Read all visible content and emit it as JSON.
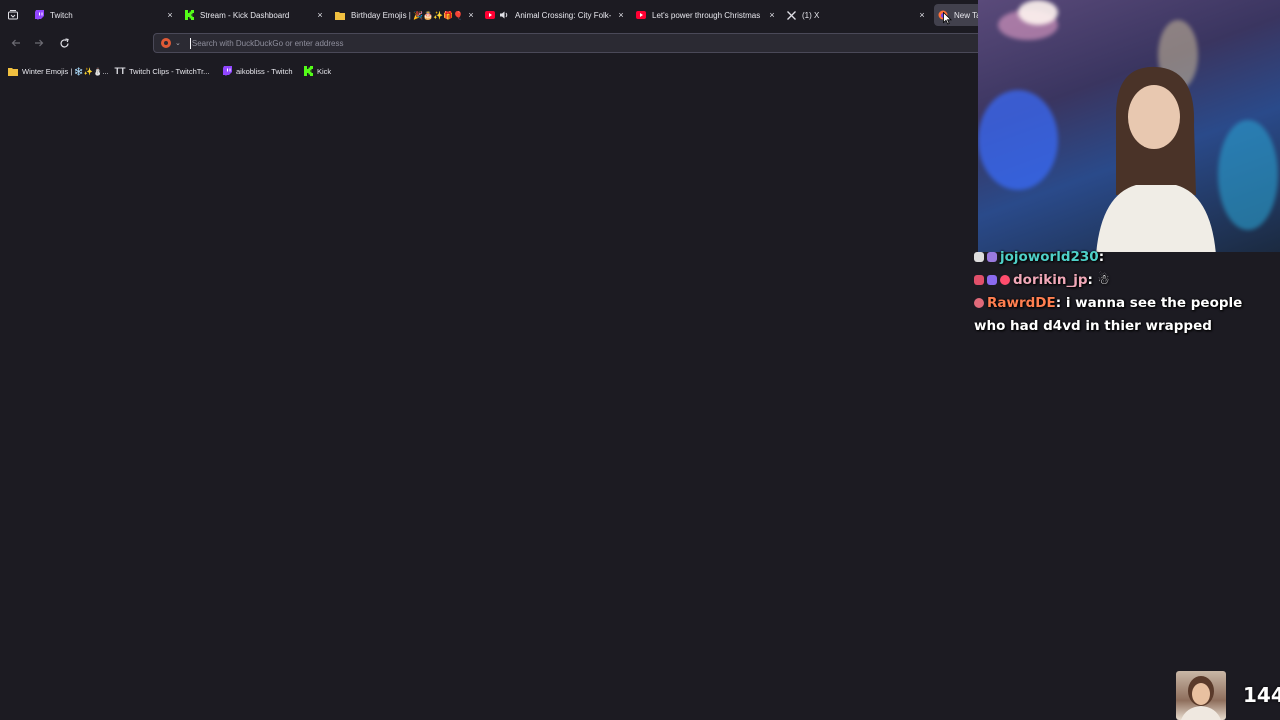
{
  "tabs": [
    {
      "title": "Twitch",
      "icon": "twitch-icon",
      "close": "×"
    },
    {
      "title": "Stream - Kick Dashboard",
      "icon": "kick-icon",
      "close": "×"
    },
    {
      "title": "Birthday Emojis | 🎉🎂✨🎁🎈",
      "icon": "folder-icon",
      "close": "×"
    },
    {
      "title": "Animal Crossing: City Folk-",
      "icon": "youtube-icon",
      "close": "×"
    },
    {
      "title": "Let's power through Christmas",
      "icon": "youtube-icon",
      "close": "×"
    },
    {
      "title": "(1) X",
      "icon": "x-icon",
      "close": "×"
    },
    {
      "title": "New Tab",
      "icon": "firefox-icon",
      "close": ""
    }
  ],
  "urlbar": {
    "placeholder": "Search with DuckDuckGo or enter address",
    "value": ""
  },
  "bookmarks": [
    {
      "label": "Winter Emojis | ❄️✨⛄...",
      "icon": "folder-icon"
    },
    {
      "label": "Twitch Clips - TwitchTr...",
      "icon": "twitchtracker-icon"
    },
    {
      "label": "aikobliss - Twitch",
      "icon": "twitch-icon"
    },
    {
      "label": "Kick",
      "icon": "kick-icon"
    }
  ],
  "chat": [
    {
      "user": "jojoworld230",
      "sep": ":",
      "message": ""
    },
    {
      "user": "dorikin_jp",
      "sep": ":",
      "message": "☃"
    },
    {
      "user": "RawrdDE",
      "sep": ":",
      "message": "i wanna see the people who had d4vd in thier wrapped"
    }
  ],
  "viewer_count": "144",
  "colors": {
    "background": "#1c1b22",
    "urlbar": "#2b2a33",
    "twitch": "#9146ff",
    "kick": "#53fc18",
    "youtube": "#ff0033"
  }
}
